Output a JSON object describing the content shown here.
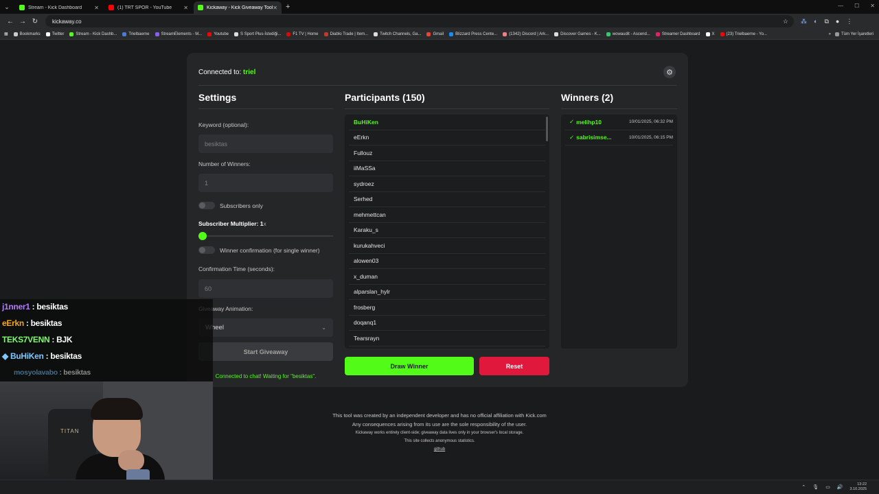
{
  "browser": {
    "tabs": [
      {
        "title": "Stream - Kick Dashboard",
        "color": "#53fc18",
        "active": false
      },
      {
        "title": "(1) TRT SPOR - YouTube",
        "color": "#ff0000",
        "active": false
      },
      {
        "title": "Kickaway - Kick Giveaway Tool",
        "color": "#53fc18",
        "active": true
      }
    ],
    "url": "kickaway.co",
    "bookmarks": [
      {
        "label": "Bookmarks",
        "color": "#cccccc"
      },
      {
        "label": "Twitter",
        "color": "#ffffff"
      },
      {
        "label": "Stream - Kick Dashb...",
        "color": "#53fc18"
      },
      {
        "label": "Trielbaerne",
        "color": "#4a7bd8"
      },
      {
        "label": "StreamElements - M...",
        "color": "#8a5cf5"
      },
      {
        "label": "Youtube",
        "color": "#ff0000"
      },
      {
        "label": "S Sport Plus-İstediği...",
        "color": "#dddddd"
      },
      {
        "label": "F1 TV | Home",
        "color": "#e10600"
      },
      {
        "label": "Diablo Trade | Item...",
        "color": "#c0392b"
      },
      {
        "label": "Twitch Channels, Ga...",
        "color": "#dddddd"
      },
      {
        "label": "Gmail",
        "color": "#ea4335"
      },
      {
        "label": "Blizzard Press Cente...",
        "color": "#148eff"
      },
      {
        "label": "(1342) Discord | Ark...",
        "color": "#f08080"
      },
      {
        "label": "Discover Games - K...",
        "color": "#dddddd"
      },
      {
        "label": "wowaudit - Ascend...",
        "color": "#2ecc71"
      },
      {
        "label": "Streamer Dashboard",
        "color": "#e91e63"
      },
      {
        "label": "X",
        "color": "#ffffff"
      },
      {
        "label": "(23) Trielbaerne - Yo...",
        "color": "#ff0000"
      }
    ],
    "bookmarks_more": "»",
    "all_bookmarks": "Tüm Yer İşaretleri"
  },
  "app": {
    "connected_prefix": "Connected to:",
    "connected_user": "triel",
    "settings": {
      "title": "Settings",
      "keyword_label": "Keyword (optional):",
      "keyword_value": "besiktas",
      "winners_label": "Number of Winners:",
      "winners_value": "1",
      "subscribers_only_label": "Subscribers only",
      "multiplier_label": "Subscriber Multiplier: 1",
      "multiplier_suffix": "x",
      "multiplier_value": 1,
      "confirmation_label": "Winner confirmation (for single winner)",
      "confirmation_time_label": "Confirmation Time (seconds):",
      "confirmation_time_value": "60",
      "animation_label": "Giveaway Animation:",
      "animation_value": "Wheel",
      "start_button": "Start Giveaway",
      "status": "Connected to chat! Waiting for \"besiktas\"."
    },
    "participants": {
      "title": "Participants (150)",
      "list": [
        "BuHiKen",
        "eErkn",
        "Fullouz",
        "iiMaSSa",
        "sydroez",
        "Serhed",
        "mehmettcan",
        "Karaku_s",
        "kurukahveci",
        "alowen03",
        "x_duman",
        "alparslan_hylr",
        "frosberg",
        "doqanq1",
        "Tearsrayn"
      ],
      "draw_button": "Draw Winner",
      "reset_button": "Reset"
    },
    "winners": {
      "title": "Winners (2)",
      "list": [
        {
          "name": "melihp10",
          "date": "10/01/2025, 06:32 PM"
        },
        {
          "name": "sabrisimse...",
          "date": "10/01/2025, 06:15 PM"
        }
      ]
    },
    "footer": {
      "line1": "This tool was created by an independent developer and has no official affiliation with Kick.com",
      "line2": "Any consequences arising from its use are the sole responsibility of the user.",
      "line3": "Kickaway works entirely client-side; giveaway data lives only in your browser's local storage.",
      "line4": "This site collects anonymous statistics.",
      "link": "github"
    }
  },
  "overlay": {
    "chat": [
      {
        "user": "j1nner1",
        "color": "#b57bff",
        "text": "besiktas"
      },
      {
        "user": "eErkn",
        "color": "#f5a623",
        "text": "besiktas"
      },
      {
        "user": "TEKS7VENN",
        "color": "#7CFC6A",
        "text": "BJK"
      },
      {
        "user": "BuHiKen",
        "color": "#7ec8ff",
        "text": "besiktas",
        "badge": "diamond"
      },
      {
        "user": "mosyolavabo",
        "color": "#7ec8ff",
        "text": "besiktas"
      }
    ],
    "chat_separator": " : ",
    "webcam_brand": "TITAN"
  },
  "taskbar": {
    "time": "13:22",
    "date": "3.10.2025"
  }
}
